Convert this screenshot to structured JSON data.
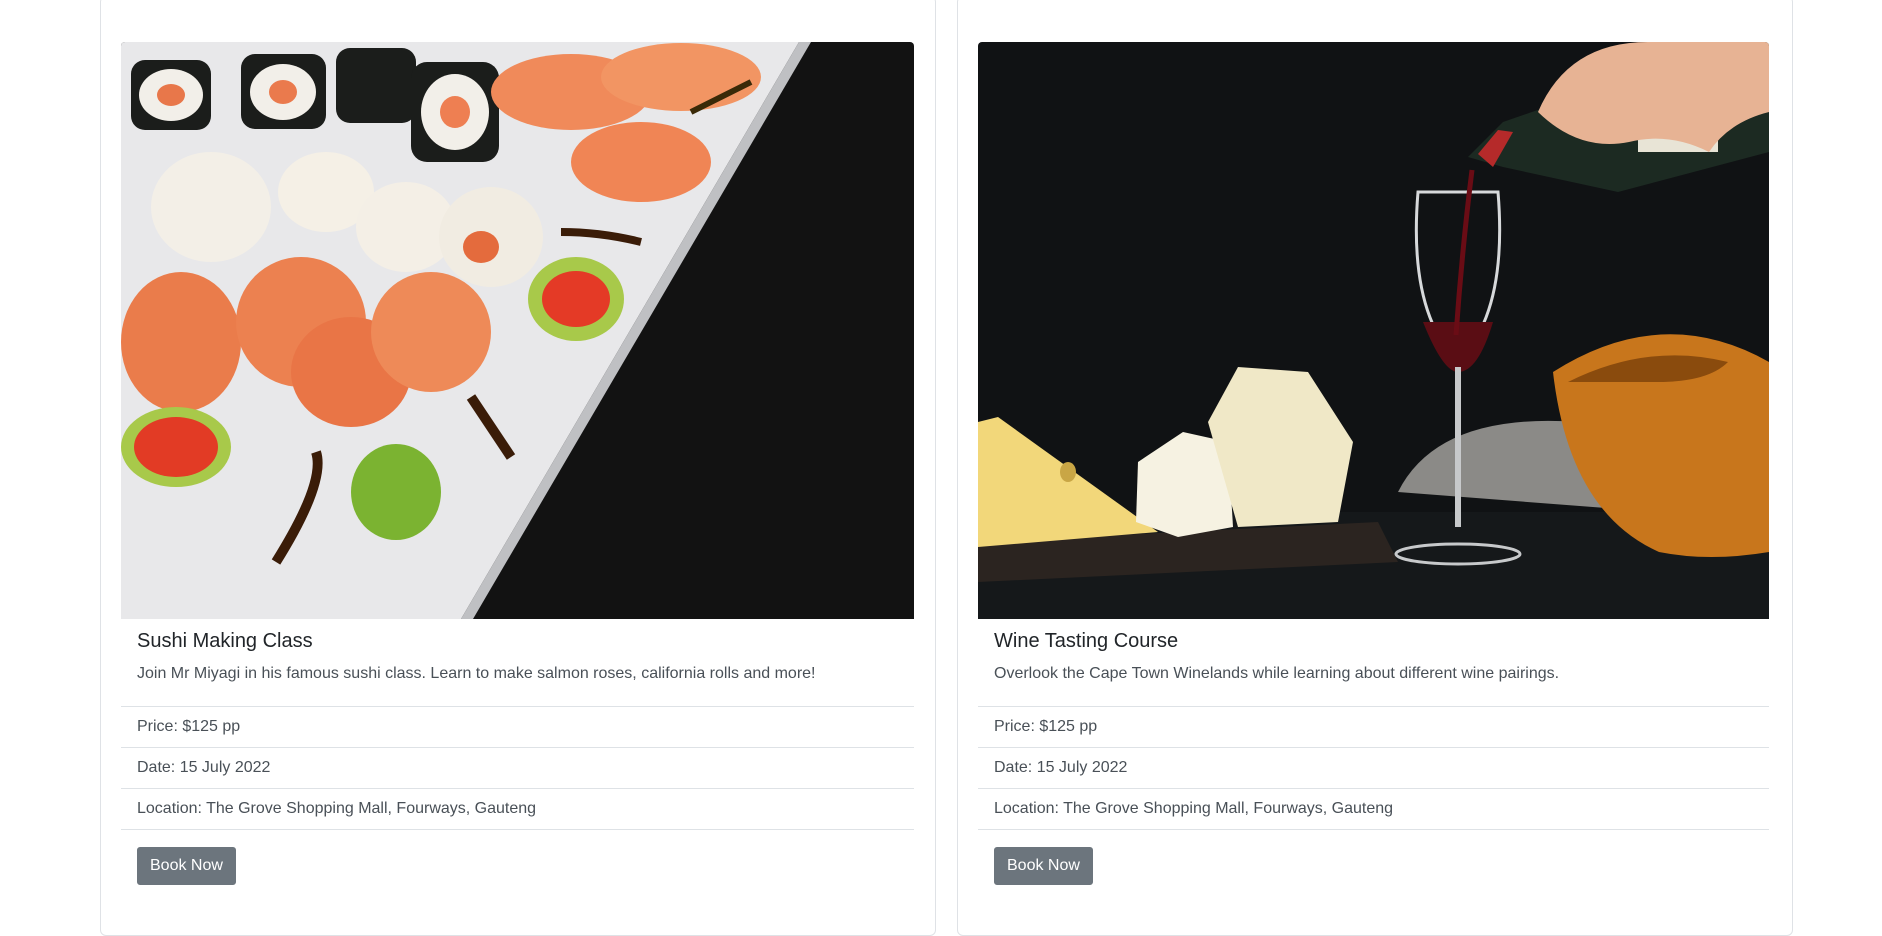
{
  "cards": [
    {
      "title": "Sushi Making Class",
      "description": "Join Mr Miyagi in his famous sushi class. Learn to make salmon roses, california rolls and more!",
      "price": "Price: $125 pp",
      "date": "Date: 15 July 2022",
      "location": "Location: The Grove Shopping Mall, Fourways, Gauteng",
      "button_label": "Book Now",
      "image": "sushi-platter-photo"
    },
    {
      "title": "Wine Tasting Course",
      "description": "Overlook the Cape Town Winelands while learning about different wine pairings.",
      "price": "Price: $125 pp",
      "date": "Date: 15 July 2022",
      "location": "Location: The Grove Shopping Mall, Fourways, Gauteng",
      "button_label": "Book Now",
      "image": "wine-and-cheese-photo"
    }
  ],
  "colors": {
    "button_bg": "#6c757d",
    "border": "#dee2e6",
    "text": "#212529",
    "muted_text": "#495057"
  }
}
